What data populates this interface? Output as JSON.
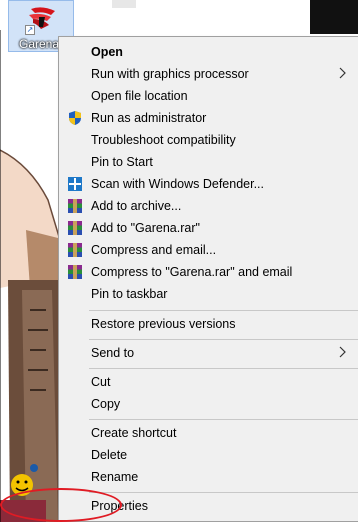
{
  "desktop_icon": {
    "label": "Garena",
    "name": "garena-shortcut"
  },
  "menu": {
    "items": [
      {
        "label": "Open",
        "bold": true
      },
      {
        "label": "Run with graphics processor",
        "submenu": true
      },
      {
        "label": "Open file location"
      },
      {
        "label": "Run as administrator",
        "icon": "shield-icon"
      },
      {
        "label": "Troubleshoot compatibility"
      },
      {
        "label": "Pin to Start"
      },
      {
        "label": "Scan with Windows Defender...",
        "icon": "defender-icon"
      },
      {
        "label": "Add to archive...",
        "icon": "winrar-icon"
      },
      {
        "label": "Add to \"Garena.rar\"",
        "icon": "winrar-icon"
      },
      {
        "label": "Compress and email...",
        "icon": "winrar-icon"
      },
      {
        "label": "Compress to \"Garena.rar\" and email",
        "icon": "winrar-icon"
      },
      {
        "label": "Pin to taskbar"
      },
      {
        "label": "Restore previous versions"
      },
      {
        "label": "Send to",
        "submenu": true
      },
      {
        "label": "Cut"
      },
      {
        "label": "Copy"
      },
      {
        "label": "Create shortcut"
      },
      {
        "label": "Delete"
      },
      {
        "label": "Rename"
      },
      {
        "label": "Properties",
        "highlighted": true
      }
    ]
  },
  "colors": {
    "menu_background": "#f0f0f0",
    "highlight_ellipse": "#e01b24",
    "separator": "#c8c8c8"
  }
}
